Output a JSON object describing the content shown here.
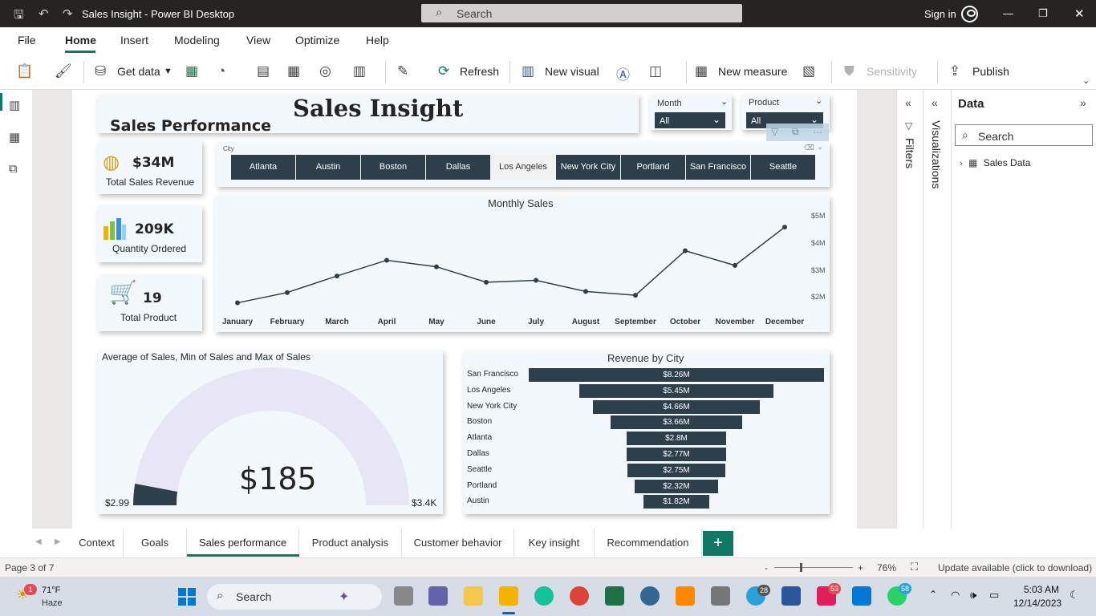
{
  "window": {
    "title": "Sales Insight - Power BI Desktop",
    "search_placeholder": "Search",
    "sign_in": "Sign in"
  },
  "menu": {
    "items": [
      "File",
      "Home",
      "Insert",
      "Modeling",
      "View",
      "Optimize",
      "Help"
    ],
    "active": "Home"
  },
  "ribbon": {
    "get_data": "Get data",
    "refresh": "Refresh",
    "new_visual": "New visual",
    "new_measure": "New measure",
    "sensitivity": "Sensitivity",
    "publish": "Publish"
  },
  "report": {
    "title": "Sales Insight",
    "subtitle": "Sales Performance",
    "month_slicer": {
      "label": "Month",
      "value": "All"
    },
    "product_slicer": {
      "label": "Product",
      "value": "All"
    },
    "city_slicer": {
      "label": "City",
      "cities": [
        "Atlanta",
        "Austin",
        "Boston",
        "Dallas",
        "Los Angeles",
        "New York City",
        "Portland",
        "San Francisco",
        "Seattle"
      ],
      "selected": "Los Angeles"
    },
    "kpis": [
      {
        "value": "$34M",
        "label": "Total Sales Revenue",
        "icon": "coins-icon"
      },
      {
        "value": "209K",
        "label": "Quantity Ordered",
        "icon": "bar-chart-icon"
      },
      {
        "value": "19",
        "label": "Total Product",
        "icon": "shopping-cart-icon"
      }
    ],
    "gauge": {
      "title": "Average of Sales, Min of Sales and Max of Sales",
      "value": "$185",
      "min": "$2.99",
      "max": "$3.4K"
    }
  },
  "chart_data": [
    {
      "type": "line",
      "title": "Monthly Sales",
      "x": [
        "January",
        "February",
        "March",
        "April",
        "May",
        "June",
        "July",
        "August",
        "September",
        "October",
        "November",
        "December"
      ],
      "series": [
        {
          "values": [
            1.82,
            2.2,
            2.81,
            3.39,
            3.15,
            2.58,
            2.65,
            2.24,
            2.1,
            3.74,
            3.2,
            4.61
          ]
        }
      ],
      "yticks": [
        "$2M",
        "$3M",
        "$4M",
        "$5M"
      ],
      "ylim": [
        1.6,
        5.0
      ],
      "y_unit": "M",
      "grid": false
    },
    {
      "type": "bar",
      "title": "Revenue by City",
      "orientation": "horizontal",
      "categories": [
        "San Francisco",
        "Los Angeles",
        "New York City",
        "Boston",
        "Atlanta",
        "Dallas",
        "Seattle",
        "Portland",
        "Austin"
      ],
      "values": [
        8.26,
        5.45,
        4.66,
        3.66,
        2.8,
        2.77,
        2.75,
        2.32,
        1.82
      ],
      "labels": [
        "$8.26M",
        "$5.45M",
        "$4.66M",
        "$3.66M",
        "$2.8M",
        "$2.77M",
        "$2.75M",
        "$2.32M",
        "$1.82M"
      ],
      "style": "funnel"
    }
  ],
  "panes": {
    "filters": "Filters",
    "visualizations": "Visualizations",
    "data_title": "Data",
    "data_search": "Search",
    "tables": [
      "Sales Data"
    ]
  },
  "tabs": {
    "items": [
      "Context",
      "Goals",
      "Sales performance",
      "Product analysis",
      "Customer behavior",
      "Key insight",
      "Recommendation"
    ],
    "active": "Sales performance"
  },
  "status": {
    "page": "Page 3 of 7",
    "zoom_minus": "-",
    "zoom_plus": "+",
    "zoom": "76%",
    "update": "Update available (click to download)"
  },
  "taskbar": {
    "weather_temp": "71°F",
    "weather_desc": "Haze",
    "weather_badge": "1",
    "search": "Search",
    "time": "5:03 AM",
    "date": "12/14/2023",
    "badges": {
      "telegram": "28",
      "slack": "53",
      "whatsapp": "58"
    }
  },
  "colors": {
    "accent": "#117865",
    "bar": "#2e3f4c",
    "card_bg": "#f3f8fd",
    "gauge_track": "#e8e6f6"
  }
}
